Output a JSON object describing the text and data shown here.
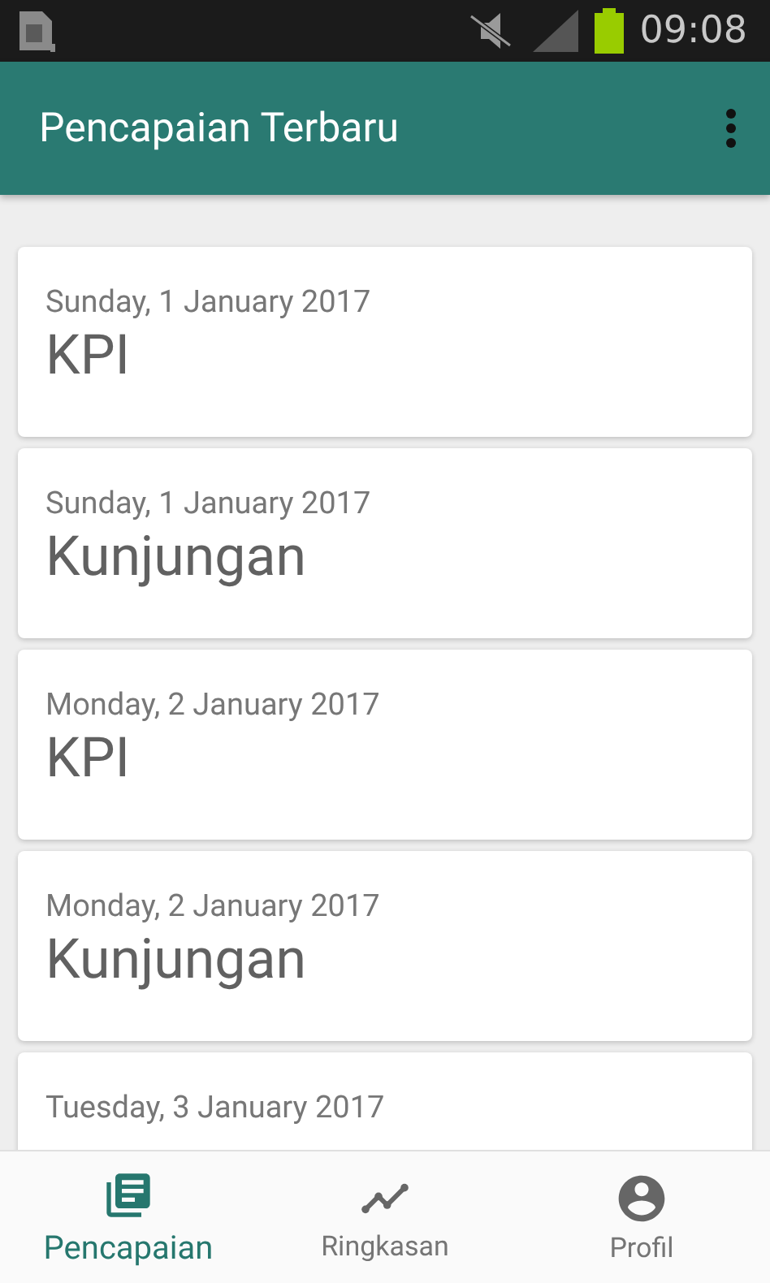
{
  "status_bar": {
    "time": "09:08"
  },
  "app_bar": {
    "title": "Pencapaian Terbaru"
  },
  "entries": [
    {
      "date": "Sunday, 1 January 2017",
      "title": "KPI"
    },
    {
      "date": "Sunday, 1 January 2017",
      "title": "Kunjungan"
    },
    {
      "date": "Monday, 2 January 2017",
      "title": "KPI"
    },
    {
      "date": "Monday, 2 January 2017",
      "title": "Kunjungan"
    },
    {
      "date": "Tuesday, 3 January 2017"
    }
  ],
  "bottom_nav": [
    {
      "kind": "achievements",
      "label": "Pencapaian",
      "selected": true
    },
    {
      "kind": "summary",
      "label": "Ringkasan",
      "selected": false
    },
    {
      "kind": "profile",
      "label": "Profil",
      "selected": false
    }
  ]
}
